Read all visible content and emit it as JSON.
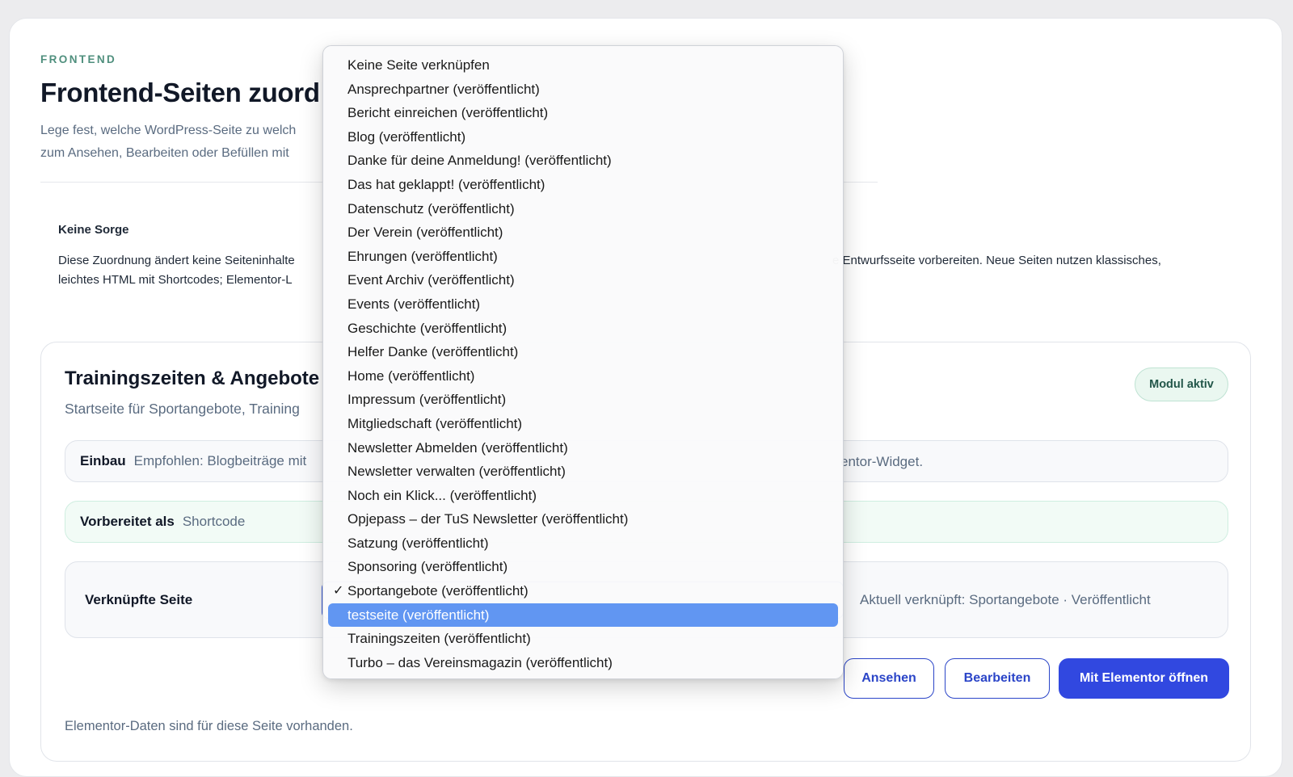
{
  "header": {
    "eyebrow": "FRONTEND",
    "title": "Frontend-Seiten zuord",
    "intro_line1": "Lege fest, welche WordPress-Seite zu welch",
    "intro_line2": "zum Ansehen, Bearbeiten oder Befüllen mit"
  },
  "note": {
    "title": "Keine Sorge",
    "text_line1": "Diese Zuordnung ändert keine Seiteninhalte",
    "text_line1_tail": "e Entwurfsseite vorbereiten. Neue Seiten nutzen klassisches,",
    "text_line2": "leichtes HTML mit Shortcodes; Elementor-L"
  },
  "module": {
    "title": "Trainingszeiten & Angebote",
    "subtitle": "Startseite für Sportangebote, Training",
    "badge": "Modul aktiv",
    "einbau_label": "Einbau",
    "einbau_value": "Empfohlen: Blogbeiträge mit",
    "einbau_tail": "entor-Widget.",
    "prepared_label": "Vorbereitet als",
    "prepared_value": "Shortcode",
    "linked_label": "Verknüpfte Seite",
    "current_link": "Aktuell verknüpft: Sportangebote · Veröffentlicht",
    "buttons": {
      "view": "Ansehen",
      "edit": "Bearbeiten",
      "elementor": "Mit Elementor öffnen"
    },
    "footer_note": "Elementor-Daten sind für diese Seite vorhanden."
  },
  "dropdown": {
    "checkmark": "✓",
    "options": [
      "Keine Seite verknüpfen",
      "Ansprechpartner (veröffentlicht)",
      "Bericht einreichen (veröffentlicht)",
      "Blog (veröffentlicht)",
      "Danke für deine Anmeldung! (veröffentlicht)",
      "Das hat geklappt! (veröffentlicht)",
      "Datenschutz (veröffentlicht)",
      "Der Verein (veröffentlicht)",
      "Ehrungen (veröffentlicht)",
      "Event Archiv (veröffentlicht)",
      "Events (veröffentlicht)",
      "Geschichte (veröffentlicht)",
      "Helfer Danke (veröffentlicht)",
      "Home (veröffentlicht)",
      "Impressum (veröffentlicht)",
      "Mitgliedschaft (veröffentlicht)",
      "Newsletter Abmelden (veröffentlicht)",
      "Newsletter verwalten (veröffentlicht)",
      "Noch ein Klick... (veröffentlicht)",
      "Opjepass – der TuS Newsletter (veröffentlicht)",
      "Satzung (veröffentlicht)",
      "Sponsoring (veröffentlicht)",
      "Sportangebote (veröffentlicht)",
      "testseite (veröffentlicht)",
      "Trainingszeiten (veröffentlicht)",
      "Turbo – das Vereinsmagazin (veröffentlicht)"
    ]
  }
}
